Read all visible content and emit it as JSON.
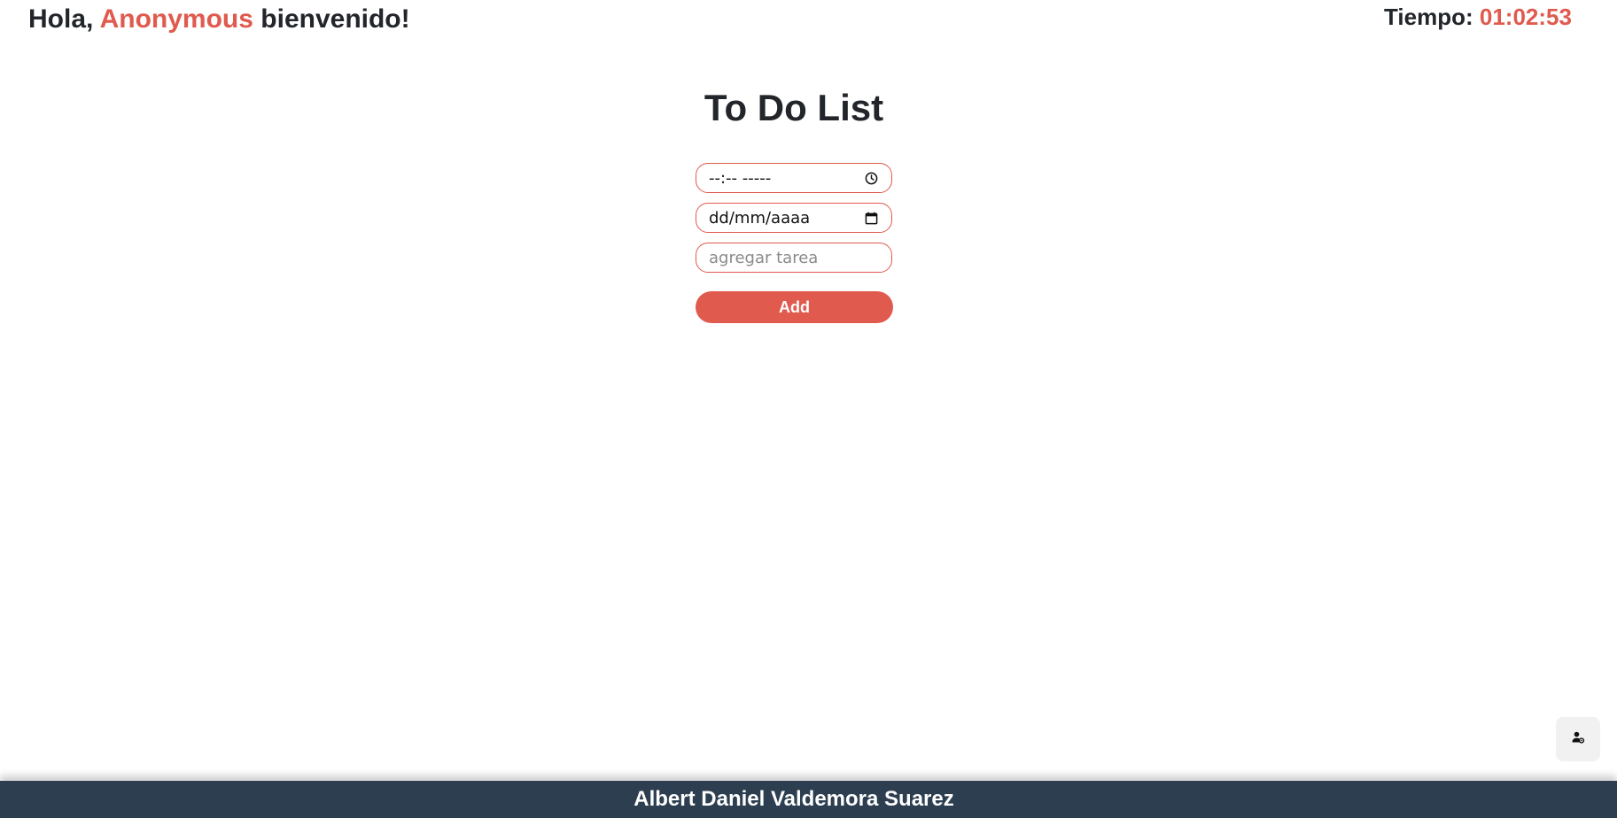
{
  "header": {
    "greeting_prefix": "Hola,",
    "user_name": "Anonymous",
    "greeting_suffix": "bienvenido!",
    "timer_label": "Tiempo:",
    "timer_value": "01:02:53"
  },
  "main": {
    "title": "To Do List",
    "time_input": {
      "value": "--:-- -----",
      "icon": "clock-icon"
    },
    "date_input": {
      "value": "dd/mm/aaaa",
      "icon": "calendar-icon"
    },
    "task_input": {
      "placeholder": "agregar tarea"
    },
    "add_button_label": "Add"
  },
  "floating_button": {
    "icon": "user-settings-icon"
  },
  "footer": {
    "author": "Albert Daniel Valdemora Suarez"
  },
  "colors": {
    "accent": "#e05a4e",
    "text": "#22262b",
    "footer_bg": "#2c3e50",
    "button_text": "#ffffff"
  }
}
